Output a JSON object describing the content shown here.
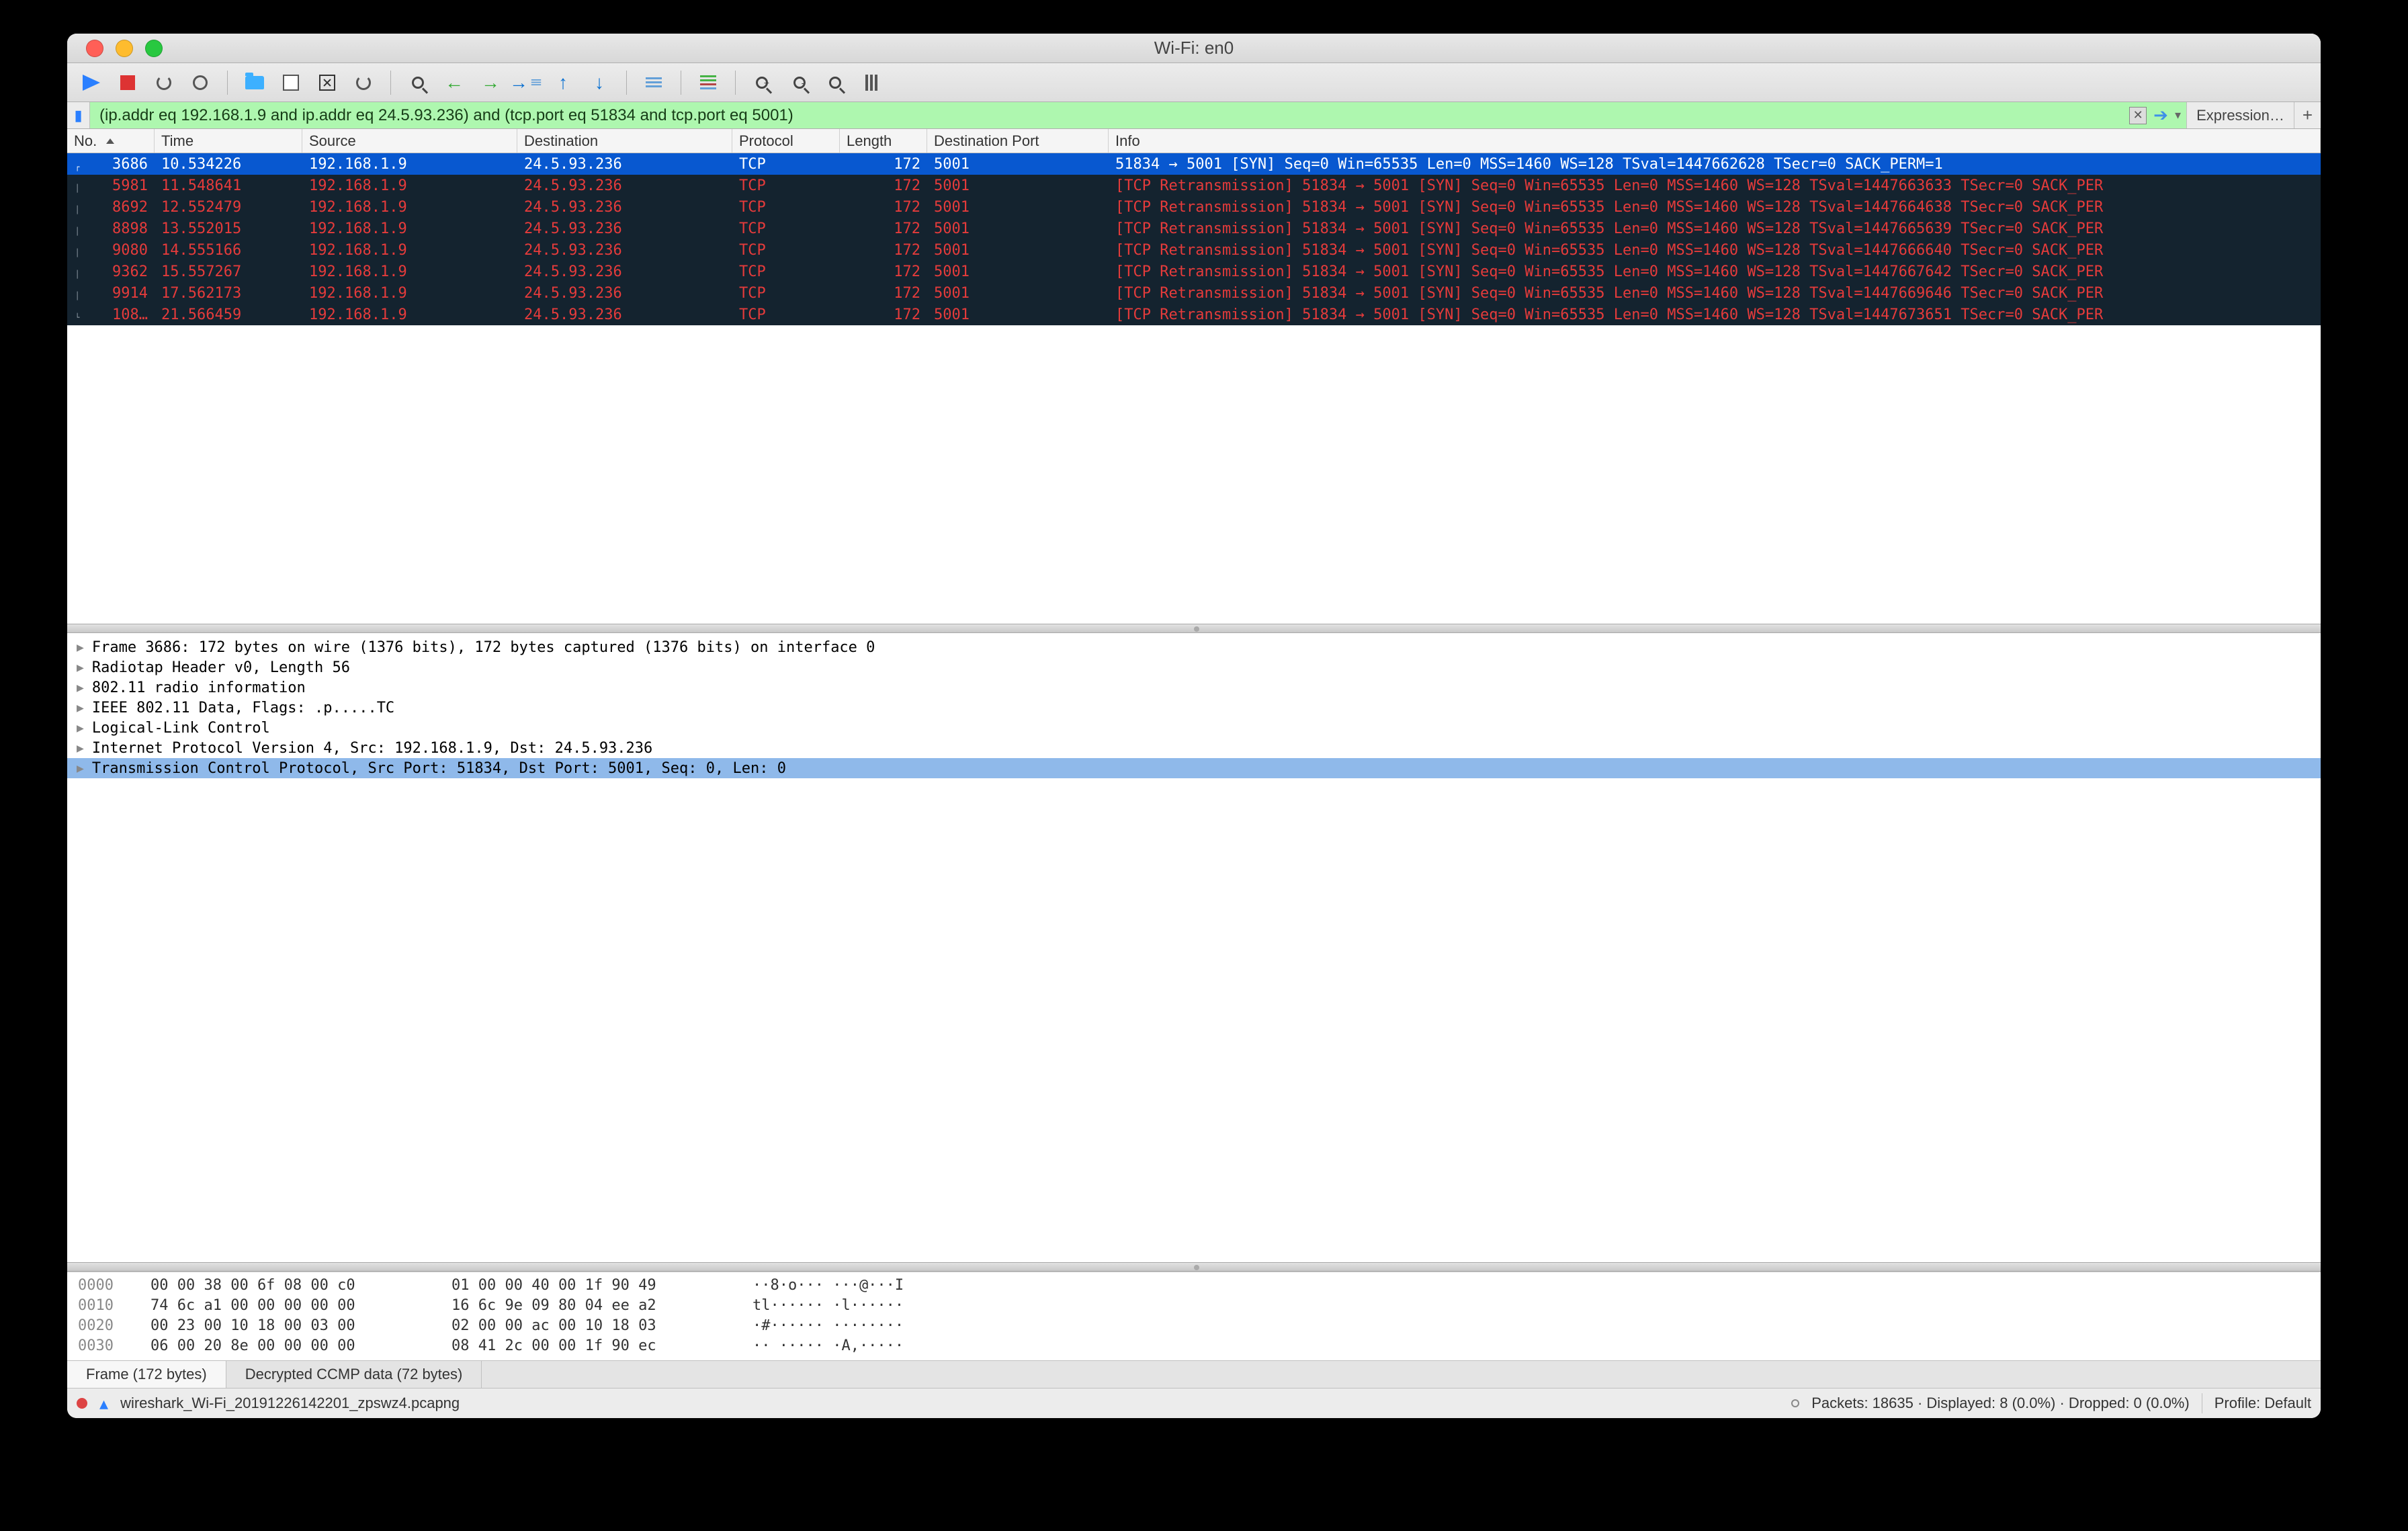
{
  "window_title": "Wi-Fi: en0",
  "display_filter": "(ip.addr eq 192.168.1.9 and ip.addr eq 24.5.93.236) and (tcp.port eq 51834 and tcp.port eq 5001)",
  "expression_label": "Expression…",
  "columns": {
    "no": "No.",
    "time": "Time",
    "source": "Source",
    "dest": "Destination",
    "proto": "Protocol",
    "len": "Length",
    "dport": "Destination Port",
    "info": "Info"
  },
  "packets": [
    {
      "no": "3686",
      "time": "10.534226",
      "src": "192.168.1.9",
      "dst": "24.5.93.236",
      "proto": "TCP",
      "len": "172",
      "dport": "5001",
      "info": "51834 → 5001 [SYN] Seq=0 Win=65535 Len=0 MSS=1460 WS=128 TSval=1447662628 TSecr=0 SACK_PERM=1",
      "selected": true
    },
    {
      "no": "5981",
      "time": "11.548641",
      "src": "192.168.1.9",
      "dst": "24.5.93.236",
      "proto": "TCP",
      "len": "172",
      "dport": "5001",
      "info": "[TCP Retransmission] 51834 → 5001 [SYN] Seq=0 Win=65535 Len=0 MSS=1460 WS=128 TSval=1447663633 TSecr=0 SACK_PER",
      "retrans": true
    },
    {
      "no": "8692",
      "time": "12.552479",
      "src": "192.168.1.9",
      "dst": "24.5.93.236",
      "proto": "TCP",
      "len": "172",
      "dport": "5001",
      "info": "[TCP Retransmission] 51834 → 5001 [SYN] Seq=0 Win=65535 Len=0 MSS=1460 WS=128 TSval=1447664638 TSecr=0 SACK_PER",
      "retrans": true
    },
    {
      "no": "8898",
      "time": "13.552015",
      "src": "192.168.1.9",
      "dst": "24.5.93.236",
      "proto": "TCP",
      "len": "172",
      "dport": "5001",
      "info": "[TCP Retransmission] 51834 → 5001 [SYN] Seq=0 Win=65535 Len=0 MSS=1460 WS=128 TSval=1447665639 TSecr=0 SACK_PER",
      "retrans": true
    },
    {
      "no": "9080",
      "time": "14.555166",
      "src": "192.168.1.9",
      "dst": "24.5.93.236",
      "proto": "TCP",
      "len": "172",
      "dport": "5001",
      "info": "[TCP Retransmission] 51834 → 5001 [SYN] Seq=0 Win=65535 Len=0 MSS=1460 WS=128 TSval=1447666640 TSecr=0 SACK_PER",
      "retrans": true
    },
    {
      "no": "9362",
      "time": "15.557267",
      "src": "192.168.1.9",
      "dst": "24.5.93.236",
      "proto": "TCP",
      "len": "172",
      "dport": "5001",
      "info": "[TCP Retransmission] 51834 → 5001 [SYN] Seq=0 Win=65535 Len=0 MSS=1460 WS=128 TSval=1447667642 TSecr=0 SACK_PER",
      "retrans": true
    },
    {
      "no": "9914",
      "time": "17.562173",
      "src": "192.168.1.9",
      "dst": "24.5.93.236",
      "proto": "TCP",
      "len": "172",
      "dport": "5001",
      "info": "[TCP Retransmission] 51834 → 5001 [SYN] Seq=0 Win=65535 Len=0 MSS=1460 WS=128 TSval=1447669646 TSecr=0 SACK_PER",
      "retrans": true
    },
    {
      "no": "108…",
      "time": "21.566459",
      "src": "192.168.1.9",
      "dst": "24.5.93.236",
      "proto": "TCP",
      "len": "172",
      "dport": "5001",
      "info": "[TCP Retransmission] 51834 → 5001 [SYN] Seq=0 Win=65535 Len=0 MSS=1460 WS=128 TSval=1447673651 TSecr=0 SACK_PER",
      "retrans": true
    }
  ],
  "details": [
    {
      "label": "Frame 3686: 172 bytes on wire (1376 bits), 172 bytes captured (1376 bits) on interface 0"
    },
    {
      "label": "Radiotap Header v0, Length 56"
    },
    {
      "label": "802.11 radio information"
    },
    {
      "label": "IEEE 802.11 Data, Flags: .p.....TC"
    },
    {
      "label": "Logical-Link Control"
    },
    {
      "label": "Internet Protocol Version 4, Src: 192.168.1.9, Dst: 24.5.93.236"
    },
    {
      "label": "Transmission Control Protocol, Src Port: 51834, Dst Port: 5001, Seq: 0, Len: 0",
      "selected": true
    }
  ],
  "hex": [
    {
      "off": "0000",
      "b1": "00 00 38 00 6f 08 00 c0",
      "b2": "01 00 00 40 00 1f 90 49",
      "asc": "··8·o··· ···@···I"
    },
    {
      "off": "0010",
      "b1": "74 6c a1 00 00 00 00 00",
      "b2": "16 6c 9e 09 80 04 ee a2",
      "asc": "tl······ ·l······"
    },
    {
      "off": "0020",
      "b1": "00 23 00 10 18 00 03 00",
      "b2": "02 00 00 ac 00 10 18 03",
      "asc": "·#······ ········"
    },
    {
      "off": "0030",
      "b1": "06 00 20 8e 00 00 00 00",
      "b2": "08 41 2c 00 00 1f 90 ec",
      "asc": "·· ····· ·A,·····"
    }
  ],
  "tabs": {
    "frame": "Frame (172 bytes)",
    "decrypted": "Decrypted CCMP data (72 bytes)"
  },
  "status": {
    "file": "wireshark_Wi-Fi_20191226142201_zpswz4.pcapng",
    "stats": "Packets: 18635 · Displayed: 8 (0.0%) · Dropped: 0 (0.0%)",
    "profile": "Profile: Default"
  }
}
